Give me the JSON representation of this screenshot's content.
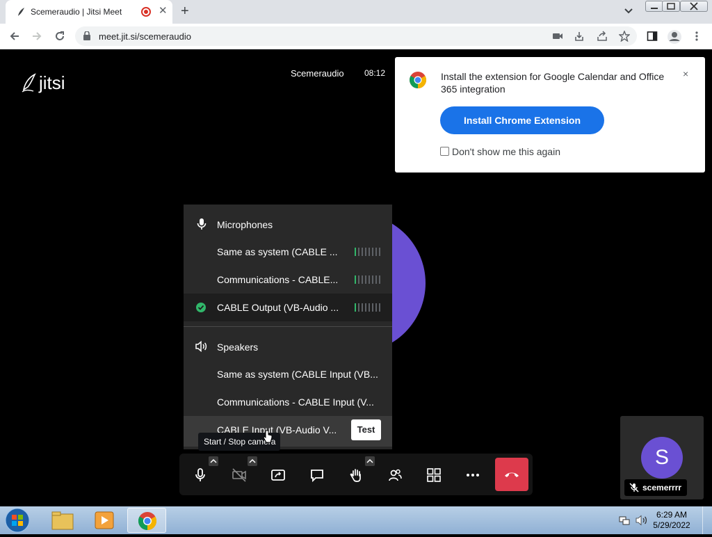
{
  "browser": {
    "tab_title": "Scemeraudio | Jitsi Meet",
    "url": "meet.jit.si/scemeraudio"
  },
  "meeting": {
    "name": "Scemeraudio",
    "timer": "08:12"
  },
  "extension_popup": {
    "message": "Install the extension for Google Calendar and Office 365 integration",
    "install_button": "Install Chrome Extension",
    "dont_show": "Don't show me this again",
    "close": "×"
  },
  "device_menu": {
    "microphones_header": "Microphones",
    "microphones": [
      {
        "label": "Same as system (CABLE ...",
        "selected": false
      },
      {
        "label": "Communications - CABLE...",
        "selected": false
      },
      {
        "label": "CABLE Output (VB-Audio ...",
        "selected": true
      }
    ],
    "speakers_header": "Speakers",
    "speakers": [
      {
        "label": "Same as system (CABLE Input (VB..."
      },
      {
        "label": "Communications - CABLE Input (V..."
      },
      {
        "label": "CABLE Input (VB-Audio V..."
      }
    ],
    "test_button": "Test"
  },
  "tooltip": "Start / Stop camera",
  "self_view": {
    "initial": "S",
    "name": "scemerrrr"
  },
  "taskbar": {
    "time": "6:29 AM",
    "date": "5/29/2022"
  },
  "colors": {
    "avatar": "#6a50d3",
    "hangup": "#dd3a4c",
    "primary_button": "#1a73e8",
    "meter_active": "#31b76a"
  }
}
